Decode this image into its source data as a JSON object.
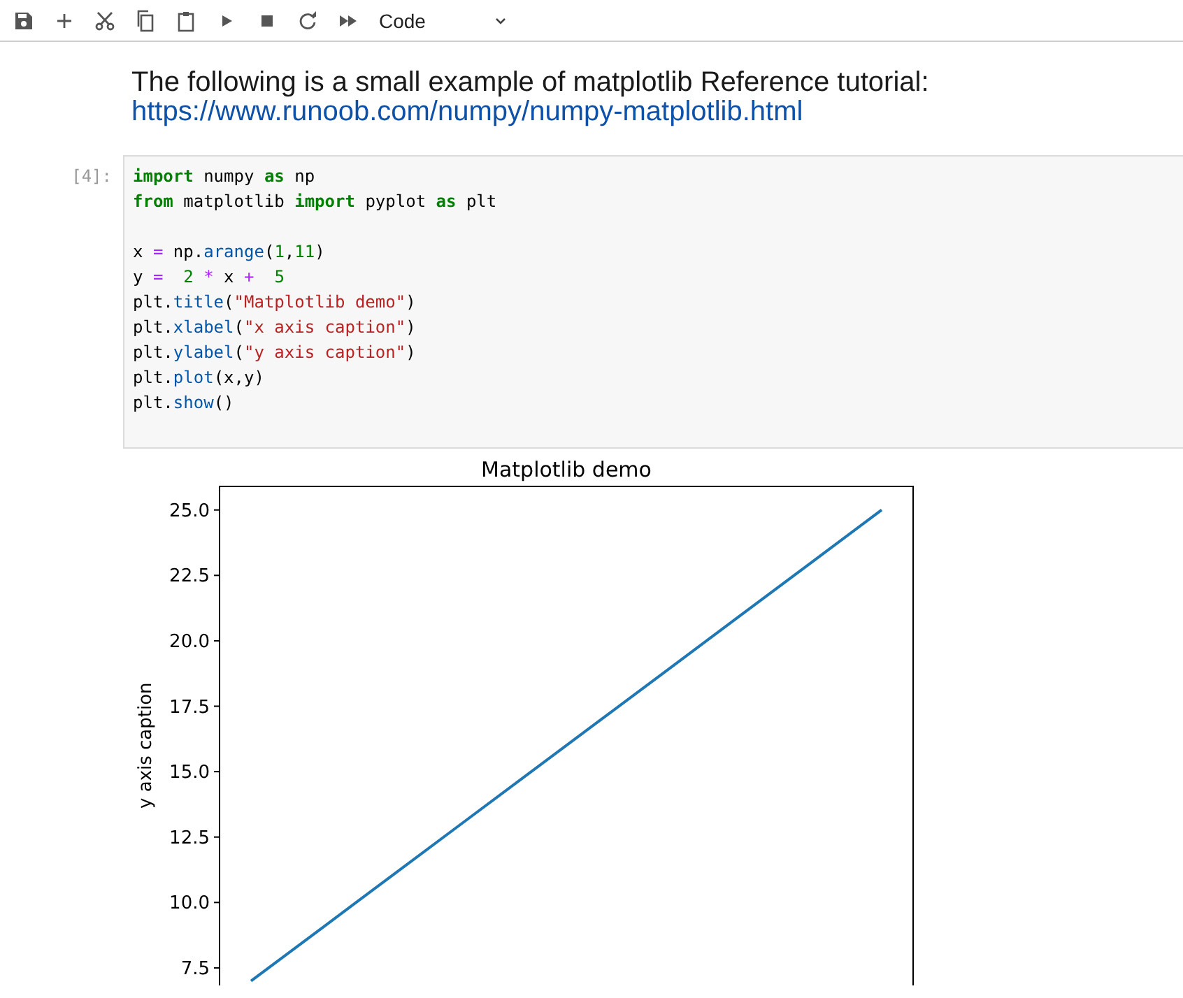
{
  "toolbar": {
    "cell_type": "Code"
  },
  "markdown_cell": {
    "text": "The following is a small example of matplotlib Reference tutorial:",
    "link": "https://www.runoob.com/numpy/numpy-matplotlib.html"
  },
  "code_cell": {
    "prompt": "[4]:",
    "lines": [
      {
        "kind": "code",
        "tokens": [
          {
            "kind": "keyword",
            "text": "import"
          },
          {
            "kind": "plain",
            "text": " numpy "
          },
          {
            "kind": "keyword",
            "text": "as"
          },
          {
            "kind": "plain",
            "text": " np"
          }
        ]
      },
      {
        "kind": "code",
        "tokens": [
          {
            "kind": "keyword",
            "text": "from"
          },
          {
            "kind": "plain",
            "text": " matplotlib "
          },
          {
            "kind": "keyword",
            "text": "import"
          },
          {
            "kind": "plain",
            "text": " pyplot "
          },
          {
            "kind": "keyword",
            "text": "as"
          },
          {
            "kind": "plain",
            "text": " plt"
          }
        ]
      },
      {
        "kind": "blank"
      },
      {
        "kind": "code",
        "tokens": [
          {
            "kind": "plain",
            "text": "x "
          },
          {
            "kind": "operator",
            "text": "= "
          },
          {
            "kind": "plain",
            "text": "np."
          },
          {
            "kind": "property",
            "text": "arange"
          },
          {
            "kind": "plain",
            "text": "("
          },
          {
            "kind": "number",
            "text": "1"
          },
          {
            "kind": "plain",
            "text": ","
          },
          {
            "kind": "number",
            "text": "11"
          },
          {
            "kind": "plain",
            "text": ")"
          }
        ]
      },
      {
        "kind": "code",
        "tokens": [
          {
            "kind": "plain",
            "text": "y "
          },
          {
            "kind": "operator",
            "text": "=  "
          },
          {
            "kind": "number",
            "text": "2 "
          },
          {
            "kind": "operator",
            "text": "* "
          },
          {
            "kind": "plain",
            "text": "x "
          },
          {
            "kind": "operator",
            "text": "+  "
          },
          {
            "kind": "number",
            "text": "5"
          }
        ]
      },
      {
        "kind": "code",
        "tokens": [
          {
            "kind": "plain",
            "text": "plt."
          },
          {
            "kind": "property",
            "text": "title"
          },
          {
            "kind": "plain",
            "text": "("
          },
          {
            "kind": "string",
            "text": "\"Matplotlib demo\""
          },
          {
            "kind": "plain",
            "text": ")"
          }
        ]
      },
      {
        "kind": "code",
        "tokens": [
          {
            "kind": "plain",
            "text": "plt."
          },
          {
            "kind": "property",
            "text": "xlabel"
          },
          {
            "kind": "plain",
            "text": "("
          },
          {
            "kind": "string",
            "text": "\"x axis caption\""
          },
          {
            "kind": "plain",
            "text": ")"
          }
        ]
      },
      {
        "kind": "code",
        "tokens": [
          {
            "kind": "plain",
            "text": "plt."
          },
          {
            "kind": "property",
            "text": "ylabel"
          },
          {
            "kind": "plain",
            "text": "("
          },
          {
            "kind": "string",
            "text": "\"y axis caption\""
          },
          {
            "kind": "plain",
            "text": ")"
          }
        ]
      },
      {
        "kind": "code",
        "tokens": [
          {
            "kind": "plain",
            "text": "plt."
          },
          {
            "kind": "property",
            "text": "plot"
          },
          {
            "kind": "plain",
            "text": "(x,y)"
          }
        ]
      },
      {
        "kind": "code",
        "tokens": [
          {
            "kind": "plain",
            "text": "plt."
          },
          {
            "kind": "property",
            "text": "show"
          },
          {
            "kind": "plain",
            "text": "()"
          }
        ]
      }
    ]
  },
  "output": {
    "chart_data": {
      "type": "line",
      "title": "Matplotlib demo",
      "ylabel": "y axis caption",
      "categories": [
        null,
        null,
        null,
        null,
        null,
        null,
        null,
        null,
        null,
        null
      ],
      "series": [
        {
          "color": "#1f77b4",
          "values": [
            7,
            9,
            11,
            13,
            15,
            17,
            19,
            21,
            23,
            25
          ]
        }
      ],
      "ylim": [
        6.83,
        25.9
      ],
      "yticks": [
        {
          "value": 7.5,
          "label": "7.5"
        },
        {
          "value": 10,
          "label": "10.0"
        },
        {
          "value": 12.5,
          "label": "12.5"
        },
        {
          "value": 15,
          "label": "15.0"
        },
        {
          "value": 17.5,
          "label": "17.5"
        },
        {
          "value": 20,
          "label": "20.0"
        },
        {
          "value": 22.5,
          "label": "22.5"
        },
        {
          "value": 25,
          "label": "25.0"
        }
      ]
    }
  }
}
